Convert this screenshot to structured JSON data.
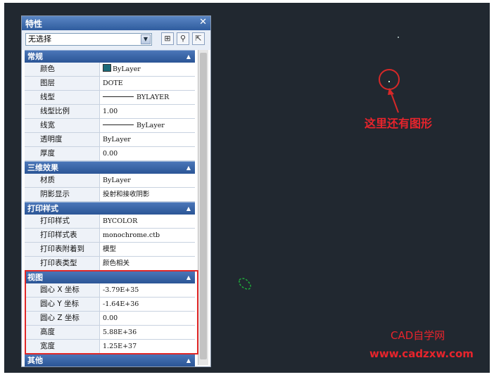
{
  "palette": {
    "title": "特性",
    "close": "✕",
    "selection": "无选择",
    "tools": [
      "⊞",
      "⚲",
      "⇱"
    ]
  },
  "sections": [
    {
      "title": "常规",
      "rows": [
        {
          "label": "颜色",
          "value": "ByLayer"
        },
        {
          "label": "图层",
          "value": "DOTE"
        },
        {
          "label": "线型",
          "value": "BYLAYER"
        },
        {
          "label": "线型比例",
          "value": "1.00"
        },
        {
          "label": "线宽",
          "value": "ByLayer"
        },
        {
          "label": "透明度",
          "value": "ByLayer"
        },
        {
          "label": "厚度",
          "value": "0.00"
        }
      ]
    },
    {
      "title": "三维效果",
      "rows": [
        {
          "label": "材质",
          "value": "ByLayer"
        },
        {
          "label": "阴影显示",
          "value": "投射和接收阴影"
        }
      ]
    },
    {
      "title": "打印样式",
      "rows": [
        {
          "label": "打印样式",
          "value": "BYCOLOR"
        },
        {
          "label": "打印样式表",
          "value": "monochrome.ctb"
        },
        {
          "label": "打印表附着到",
          "value": "模型"
        },
        {
          "label": "打印表类型",
          "value": "颜色相关"
        }
      ]
    },
    {
      "title": "视图",
      "rows": [
        {
          "label": "圆心 X 坐标",
          "value": "-3.79E+35"
        },
        {
          "label": "圆心 Y 坐标",
          "value": "-1.64E+36"
        },
        {
          "label": "圆心 Z 坐标",
          "value": "0.00"
        },
        {
          "label": "高度",
          "value": "5.88E+36"
        },
        {
          "label": "宽度",
          "value": "1.25E+37"
        }
      ]
    },
    {
      "title": "其他",
      "rows": []
    }
  ],
  "colors": {
    "layer_swatch": "#1c6a78",
    "highlight": "#e02828",
    "canvas": "#212830"
  },
  "annotations": {
    "arrow_note": "这里还有图形",
    "brand": "CAD自学网",
    "url": "www.cadzxw.com"
  }
}
